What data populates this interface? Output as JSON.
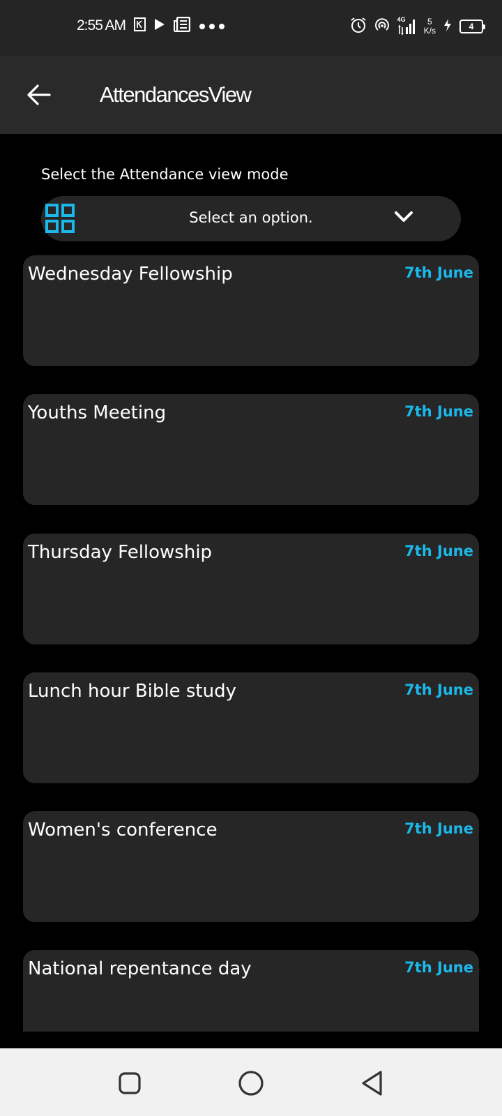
{
  "status_bar": {
    "time": "2:55 AM",
    "network_type": "4G",
    "net_speed_value": "5",
    "net_speed_unit": "K/s",
    "battery": "4",
    "icons": [
      "k-notification-icon",
      "play-icon",
      "news-icon",
      "more-dots-icon",
      "alarm-icon",
      "hotspot-icon",
      "signal-icon",
      "charging-icon",
      "battery-icon"
    ]
  },
  "header": {
    "title": "AttendancesView"
  },
  "view_mode": {
    "label": "Select the Attendance view mode",
    "value": "Select an option.",
    "icon": "grid-icon"
  },
  "events": [
    {
      "name": "Wednesday Fellowship",
      "date": "7th June"
    },
    {
      "name": "Youths Meeting",
      "date": "7th June"
    },
    {
      "name": "Thursday Fellowship",
      "date": "7th June"
    },
    {
      "name": "Lunch hour Bible study",
      "date": "7th June"
    },
    {
      "name": "Women's conference",
      "date": "7th June"
    },
    {
      "name": "National repentance day",
      "date": "7th June"
    }
  ],
  "colors": {
    "accent": "#1bb8ea",
    "card": "#262626",
    "background": "#000000",
    "app_bar": "#2a2a2a",
    "nav_bar": "#f1f1f1"
  },
  "nav_bar": {
    "icons": [
      "recent-apps-icon",
      "home-icon",
      "back-icon"
    ]
  }
}
